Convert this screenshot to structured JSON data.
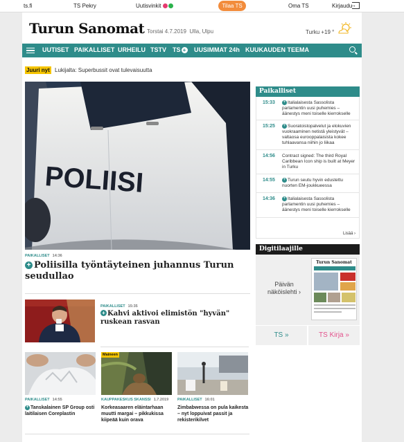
{
  "topbar": {
    "home": "ts.fi",
    "pekry": "TS Pekry",
    "tips": "Uutisvinkit",
    "subscribe": "Tilaa TS",
    "own": "Oma TS",
    "login": "Kirjaudu"
  },
  "header": {
    "logo": "Turun Sanomat",
    "date": "Torstai 4.7.2019",
    "nameday": "Ulla, Ulpu",
    "weather": "Turku +19 °"
  },
  "nav": {
    "items": [
      "UUTISET",
      "PAIKALLISET",
      "URHEILU",
      "TSTV",
      "TS",
      "UUSIMMAT 24h",
      "KUUKAUDEN TEEMA"
    ]
  },
  "juuri": {
    "label": "Juuri nyt",
    "text": "Lukijalta: Superbussit ovat tulevaisuutta"
  },
  "hero": {
    "category": "PAIKALLISET",
    "time": "14:36",
    "title": "Poliisilla työntäyteinen juhannus Turun seudullao",
    "image_text": "POLIISI"
  },
  "article2": {
    "category": "PAIKALLISET",
    "time": "15:35",
    "title": "Kahvi aktivoi elimistön \"hyvän\" ruskean rasvan"
  },
  "cards": [
    {
      "category": "PAIKALLISET",
      "time": "14:55",
      "title": "Tanskalainen SP Group osti laitilaisen Coreplastin"
    },
    {
      "category": "KAUPPAKESKUS SKANSSI",
      "time": "1.7.2019",
      "title": "Korkeasaaren eläintarhaan muutti margai – pikkukissa kiipeää kuin orava",
      "badge": "Maineen"
    },
    {
      "category": "PAIKALLISET",
      "time": "16:01",
      "title": "Zimbabwessa on pula kaikesta – nyt loppuivat passit ja rekisterikilvet"
    }
  ],
  "sidebar": {
    "title": "Paikalliset",
    "items": [
      {
        "time": "15:33",
        "text": "Italialaisesta Sassolista parlamentin uusi puhemies – äänestys meni toiselle kierrokselle"
      },
      {
        "time": "15:25",
        "text": "Suoratoistopalvelut ja elokuvien vuokraaminen netistä yleistyvät – valtaosa eurooppalaisista kokee tuhlaavansa niihin jo liikaa"
      },
      {
        "time": "14:56",
        "text": "Contract signed: The third Royal Caribbean Icon ship is built at Meyer in Turku"
      },
      {
        "time": "14:55",
        "text": "Turun seutu hyvin edustettu nuorten EM-joukkueessa"
      },
      {
        "time": "14:36",
        "text": "Italialaisesta Sassolista parlamentin uusi puhemies – äänestys meni toiselle kierrokselle"
      }
    ],
    "more": "Lisää ›"
  },
  "digi": {
    "title": "Digitilaajille",
    "text": "Päivän näköislehti ›",
    "paper_logo": "Turun Sanomat",
    "ts_button": "TS »",
    "kirja_button": "TS Kirja »"
  },
  "colors": {
    "accent": "#2e8c8a",
    "subscribe": "#f28c3c",
    "highlight": "#f5c400",
    "kirja": "#e3508b"
  }
}
